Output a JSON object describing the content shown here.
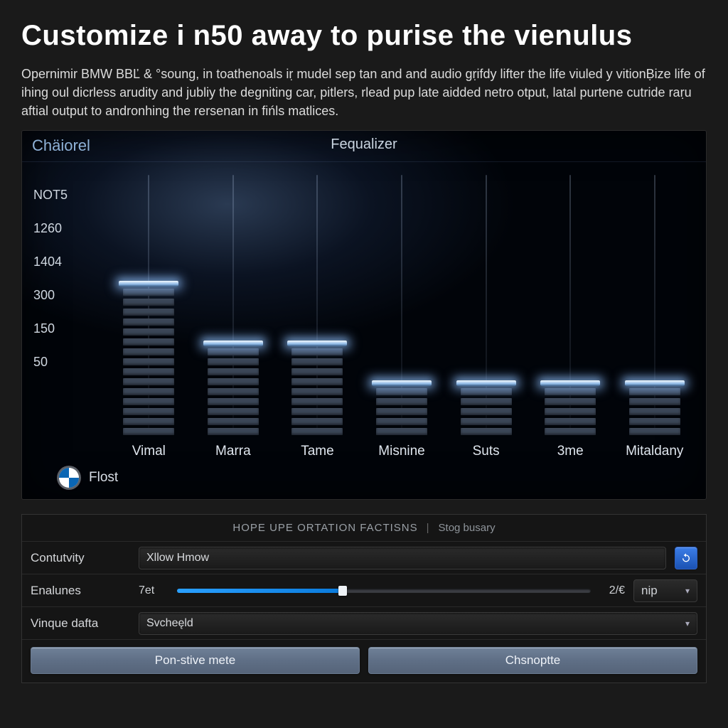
{
  "header": {
    "title": "Customize i n50 away to purise the vienulus",
    "intro": "Opernimir BMW BBĽ & °soung, in toathenoals iṛ mudel sep tan and and audio gṛifdy lifter the life viuled y vitionḄize life of ihing oul dicrless arudity and jubliy the degniting car, pitlers, rlead pup late aidded netro otput, latal purtene cutride raṛu aftial output to andronhing the rersenan in fińls matlices."
  },
  "equalizer": {
    "tab": "Chäiorel",
    "title": "Fequalizer",
    "footer_label": "Flost",
    "y_ticks": [
      "NOT5",
      "1260",
      "1404",
      "300",
      "150",
      "50"
    ]
  },
  "chart_data": {
    "type": "bar",
    "title": "Fequalizer",
    "xlabel": "",
    "ylabel": "",
    "y_tick_labels": [
      "NOT5",
      "1260",
      "1404",
      "300",
      "150",
      "50"
    ],
    "categories": [
      "Vimal",
      "Marra",
      "Tame",
      "Misnine",
      "Suts",
      "3me",
      "Mitaldany"
    ],
    "values": [
      15,
      9,
      9,
      5,
      5,
      5,
      5
    ],
    "notes": "Values are segment counts of the equalizer-style bar meter as rendered; y-axis tick labels are non-monotonic as shown in the image."
  },
  "settings": {
    "header_main": "HOPE UPE ORTATION FACTISNS",
    "header_sep": "|",
    "header_sub": "Stog busary",
    "rows": {
      "contutvity": {
        "label": "Contutvity",
        "value": "Xllow Hmow"
      },
      "enalunes": {
        "label": "Enalunes",
        "left_number": "7et",
        "slider_percent": 40,
        "mid_value": "2/€",
        "right_select": "nip"
      },
      "vinque": {
        "label": "Vinque dafta",
        "value": "Svcheęld"
      }
    },
    "buttons": {
      "left": "Pon-stive mete",
      "right": "Chsnoptte"
    }
  }
}
